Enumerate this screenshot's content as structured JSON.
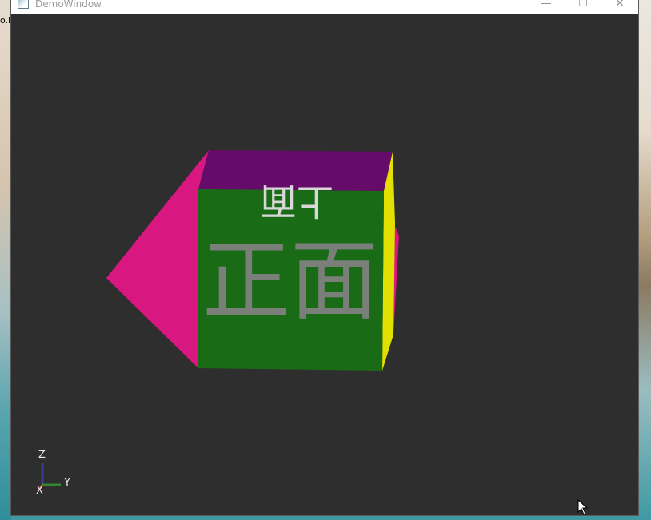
{
  "window": {
    "title": "DemoWindow",
    "minimize_glyph": "—",
    "maximize_glyph": "☐",
    "close_glyph": "✕"
  },
  "desktop": {
    "fragment_text": "o.l"
  },
  "scene": {
    "background": "#2e2e2e",
    "front_face": {
      "text": "正面",
      "color": "#1a6b16",
      "text_color": "#7a7f7a"
    },
    "top_face": {
      "text": "上面",
      "color": "#650b6a",
      "text_color": "#d8d8d8"
    },
    "right_face": {
      "color": "#e1e000"
    },
    "left_face": {
      "color": "#d91780"
    }
  },
  "axes": {
    "z_label": "Z",
    "y_label": "Y",
    "x_label": "X",
    "z_color": "#3c3c8c",
    "y_color": "#2f8a2f",
    "x_color": "#b0402a"
  }
}
